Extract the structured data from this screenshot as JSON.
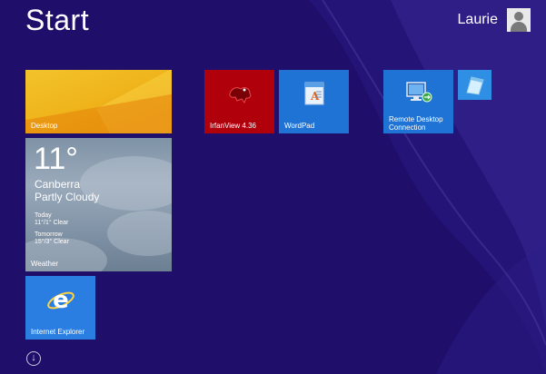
{
  "header": {
    "title": "Start",
    "user_name": "Laurie"
  },
  "tiles": {
    "desktop": {
      "label": "Desktop"
    },
    "weather": {
      "temperature": "11°",
      "city": "Canberra",
      "condition": "Partly Cloudy",
      "today_label": "Today",
      "today_forecast": "11°/1° Clear",
      "tomorrow_label": "Tomorrow",
      "tomorrow_forecast": "15°/3° Clear",
      "label": "Weather"
    },
    "ie": {
      "label": "Internet Explorer"
    },
    "irfanview": {
      "label": "IrfanView 4.36"
    },
    "wordpad": {
      "label": "WordPad"
    },
    "rdc": {
      "label": "Remote Desktop Connection"
    },
    "notepad": {
      "icon": "notepad-icon"
    }
  },
  "footer": {
    "all_apps_icon": "down-arrow-icon"
  },
  "colors": {
    "background": "#1f0f6b",
    "desktop_tile": "#f0b51c",
    "irfanview_tile": "#b0000c",
    "wordpad_tile": "#1f73d4",
    "ie_tile": "#2a7de1"
  }
}
